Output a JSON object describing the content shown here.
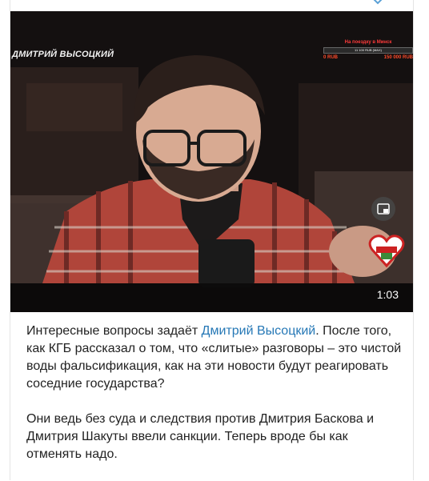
{
  "video": {
    "streamer_name": "ДМИТРИЙ ВЫСОЦКИЙ",
    "donation_goal": {
      "title": "На поездку в Минск",
      "bar_label": "11 100 RUB (MAX)",
      "progress": 0.0,
      "left_value": "0 RUB",
      "right_value": "150 000 RUB"
    },
    "duration": "1:03",
    "pip_icon": "picture-in-picture-icon"
  },
  "post": {
    "line1_prefix": "Интересные вопросы задаёт ",
    "line1_link": "Дмитрий Высоцкий",
    "line1_suffix": ".",
    "paragraph1_rest": "После того, как КГБ рассказал о том, что «слитые» разговоры – это чистой воды фальсификация, как на эти новости будут реагировать соседние государства?",
    "paragraph2": "Они ведь без суда и следствия против Дмитрия Баскова и Дмитрия Шакуты ввели санкции. Теперь вроде бы как отменять надо."
  },
  "colors": {
    "link": "#2678b6",
    "text": "#222222",
    "video_bg": "#0f0d0d"
  }
}
